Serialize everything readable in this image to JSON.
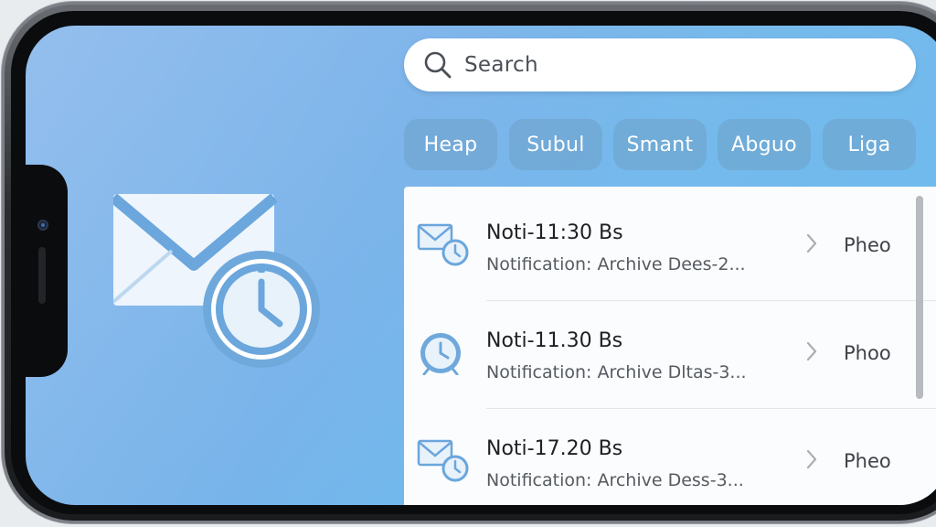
{
  "search": {
    "placeholder": "Search"
  },
  "filters": [
    "Heap",
    "Subul",
    "Smant",
    "Abguo",
    "Liga"
  ],
  "notifications": [
    {
      "icon": "mail-clock-icon",
      "title": "Noti-11:30 Bs",
      "subtitle": "Notification: Archive Dees-2...",
      "meta": "Pheo"
    },
    {
      "icon": "alarm-clock-icon",
      "title": "Noti-11.30 Bs",
      "subtitle": "Notification: Archive Dltas-3...",
      "meta": "Phoo"
    },
    {
      "icon": "mail-clock-icon",
      "title": "Noti-17.20 Bs",
      "subtitle": "Notification: Archive Dess-3...",
      "meta": "Pheo"
    }
  ],
  "colors": {
    "accent": "#5aa0d8",
    "background": "#7ab6ea"
  }
}
